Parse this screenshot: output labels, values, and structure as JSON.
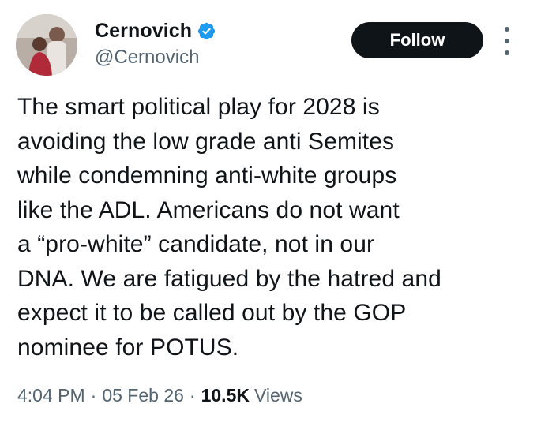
{
  "author": {
    "display_name": "Cernovich",
    "handle": "@Cernovich",
    "verified": true
  },
  "follow_label": "Follow",
  "tweet": {
    "text": "The smart political play for 2028 is\navoiding the low grade anti Semites\nwhile condemning anti-white groups\nlike the ADL. Americans do not want\na “pro-white” candidate, not in our\nDNA. We are fatigued by the hatred and\nexpect it to be called out by the GOP\nnominee for POTUS."
  },
  "meta": {
    "time": "4:04 PM",
    "separator": "·",
    "date": "05 Feb 26",
    "views_count": "10.5K",
    "views_label": "Views"
  },
  "colors": {
    "accent_verified": "#1d9bf0",
    "follow_bg": "#0f1419",
    "secondary_text": "#536471"
  },
  "icons": {
    "verified": "verified-badge-icon",
    "more": "more-options-icon"
  }
}
